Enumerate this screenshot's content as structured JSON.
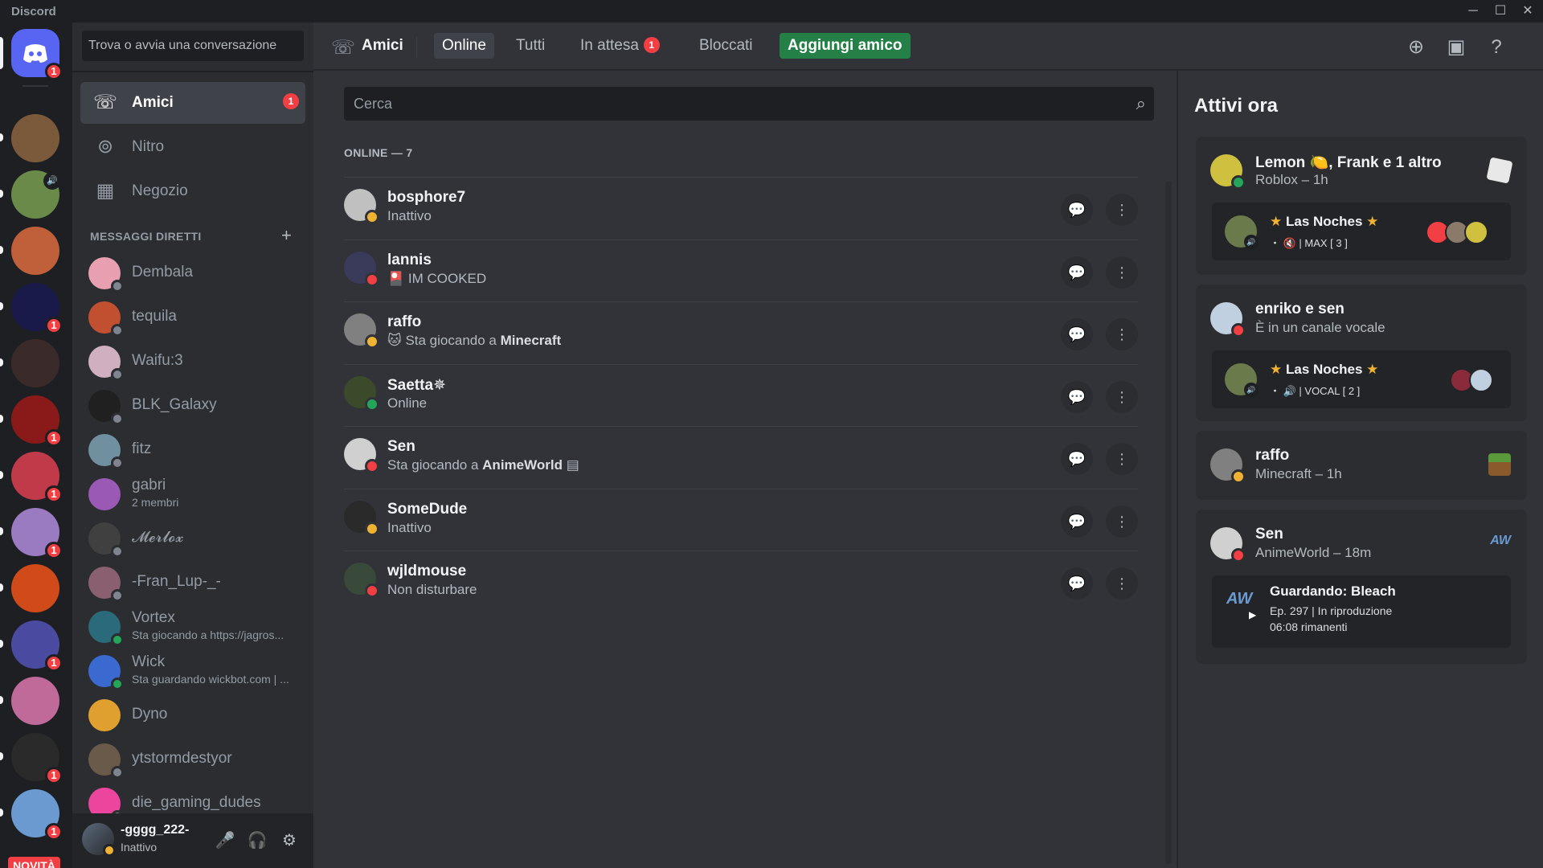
{
  "window": {
    "brand": "Discord",
    "min": "─",
    "max": "☐",
    "close": "✕"
  },
  "rail": {
    "home_badge": "1",
    "servers": [
      {
        "name": "server-1",
        "color": "#7a5a3a",
        "badge": "",
        "vol": false
      },
      {
        "name": "server-2",
        "color": "#6a8a4a",
        "badge": "",
        "vol": true
      },
      {
        "name": "server-3",
        "color": "#c0603a",
        "badge": "",
        "vol": false
      },
      {
        "name": "server-psi",
        "color": "#1a1a4a",
        "badge": "1",
        "vol": false
      },
      {
        "name": "server-humanitys-fate",
        "color": "#3a2a2a",
        "badge": "",
        "vol": false
      },
      {
        "name": "server-a",
        "color": "#8a1a1a",
        "badge": "1",
        "vol": false
      },
      {
        "name": "server-7",
        "color": "#c03a4a",
        "badge": "1",
        "vol": false
      },
      {
        "name": "server-8",
        "color": "#9a7ac0",
        "badge": "1",
        "vol": false
      },
      {
        "name": "server-9",
        "color": "#d04a1a",
        "badge": "",
        "vol": false
      },
      {
        "name": "server-10",
        "color": "#4a4aa0",
        "badge": "1",
        "vol": false
      },
      {
        "name": "server-11",
        "color": "#c06a9a",
        "badge": "",
        "vol": false
      },
      {
        "name": "server-12",
        "color": "#2a2a2a",
        "badge": "1",
        "vol": false
      },
      {
        "name": "server-13",
        "color": "#6a9ad0",
        "badge": "1",
        "vol": false
      }
    ],
    "novita": "NOVITÀ"
  },
  "dm_sidebar": {
    "search_placeholder": "Trova o avvia una conversazione",
    "nav": [
      {
        "label": "Amici",
        "icon": "☏",
        "badge": "1",
        "active": true
      },
      {
        "label": "Nitro",
        "icon": "⊚",
        "badge": "",
        "active": false
      },
      {
        "label": "Negozio",
        "icon": "▦",
        "badge": "",
        "active": false
      }
    ],
    "dm_header": "MESSAGGI DIRETTI",
    "add_dm": "+",
    "dms": [
      {
        "name": "Dembala",
        "sub": "",
        "color": "#e8a0b0",
        "status": "#80848e"
      },
      {
        "name": "tequila",
        "sub": "",
        "color": "#c05030",
        "status": "#80848e"
      },
      {
        "name": "Waifu:3",
        "sub": "",
        "color": "#d0b0c0",
        "status": "#80848e"
      },
      {
        "name": "BLK_Galaxy",
        "sub": "",
        "color": "#202020",
        "status": "#80848e"
      },
      {
        "name": "fitz",
        "sub": "",
        "color": "#7090a0",
        "status": "#80848e"
      },
      {
        "name": "gabri",
        "sub": "2 membri",
        "color": "#9b59b6",
        "status": ""
      },
      {
        "name": "𝓜𝓮𝓻𝓵𝓸𝔁",
        "sub": "",
        "color": "#404040",
        "status": "#80848e"
      },
      {
        "name": "-Fran_Lup-_-",
        "sub": "",
        "color": "#8a6070",
        "status": "#80848e"
      },
      {
        "name": "Vortex",
        "sub": "Sta giocando a https://jagros...",
        "color": "#2a6a7a",
        "status": "#23a55a"
      },
      {
        "name": "Wick",
        "sub": "Sta guardando wickbot.com | ...",
        "color": "#3a6ad0",
        "status": "#23a55a"
      },
      {
        "name": "Dyno",
        "sub": "",
        "color": "#e0a030",
        "status": ""
      },
      {
        "name": "ytstormdestyor",
        "sub": "",
        "color": "#6a5a4a",
        "status": "#80848e"
      },
      {
        "name": "die_gaming_dudes",
        "sub": "",
        "color": "#eb459e",
        "status": "#80848e"
      }
    ],
    "user": {
      "name": "-gggg_222-",
      "status": "Inattivo",
      "mic": "🎤",
      "headset": "🎧",
      "settings": "⚙"
    }
  },
  "topbar": {
    "title": "Amici",
    "tabs": [
      {
        "label": "Online",
        "kind": "sel",
        "badge": ""
      },
      {
        "label": "Tutti",
        "kind": "",
        "badge": ""
      },
      {
        "label": "In attesa",
        "kind": "",
        "badge": "1"
      },
      {
        "label": "Bloccati",
        "kind": "",
        "badge": ""
      },
      {
        "label": "Aggiungi amico",
        "kind": "add",
        "badge": ""
      }
    ]
  },
  "friends": {
    "search_placeholder": "Cerca",
    "section": "ONLINE — 7",
    "list": [
      {
        "name": "bosphore7",
        "status_text": "Inattivo",
        "color": "#c0c0c0",
        "status": "#f0b232"
      },
      {
        "name": "lannis",
        "status_text": "🎴 IM COOKED",
        "color": "#3a3a5a",
        "status": "#f23f43"
      },
      {
        "name": "raffo",
        "status_text_pre": "🐱 Sta giocando a ",
        "status_bold": "Minecraft",
        "color": "#808080",
        "status": "#f0b232"
      },
      {
        "name": "Saetta✵",
        "status_text": "Online",
        "color": "#3a4a2a",
        "status": "#23a55a"
      },
      {
        "name": "Sen",
        "status_text_pre": "Sta giocando a ",
        "status_bold": "AnimeWorld",
        "status_text_post": " ▤",
        "color": "#d0d0d0",
        "status": "#f23f43"
      },
      {
        "name": "SomeDude",
        "status_text": "Inattivo",
        "color": "#2a2a2a",
        "status": "#f0b232"
      },
      {
        "name": "wjldmouse",
        "status_text": "Non disturbare",
        "color": "#3a4a3a",
        "status": "#f23f43"
      }
    ],
    "msg_icon": "💬",
    "more_icon": "⋮"
  },
  "activity": {
    "title": "Attivi ora",
    "cards": [
      {
        "name": "Lemon 🍋, Frank e 1 altro",
        "sub": "Roblox – 1h",
        "color": "#d0c040",
        "status": "#23a55a",
        "inner": {
          "name": "Las Noches",
          "sub": "・ 🔇 | MAX [ 3 ]"
        }
      },
      {
        "name": "enriko e sen",
        "sub": "È in un canale vocale",
        "color": "#c0d0e0",
        "status": "#f23f43",
        "inner": {
          "name": "Las Noches",
          "sub": "・ 🔊 | VOCAL [ 2 ]"
        }
      },
      {
        "name": "raffo",
        "sub": "Minecraft – 1h",
        "color": "#808080",
        "status": "#f0b232"
      },
      {
        "name": "Sen",
        "sub": "AnimeWorld – 18m",
        "color": "#d0d0d0",
        "status": "#f23f43",
        "watch": {
          "title": "Guardando: Bleach",
          "line1": "Ep. 297 | In riproduzione",
          "line2": "06:08 rimanenti",
          "logo": "AW"
        }
      }
    ]
  }
}
